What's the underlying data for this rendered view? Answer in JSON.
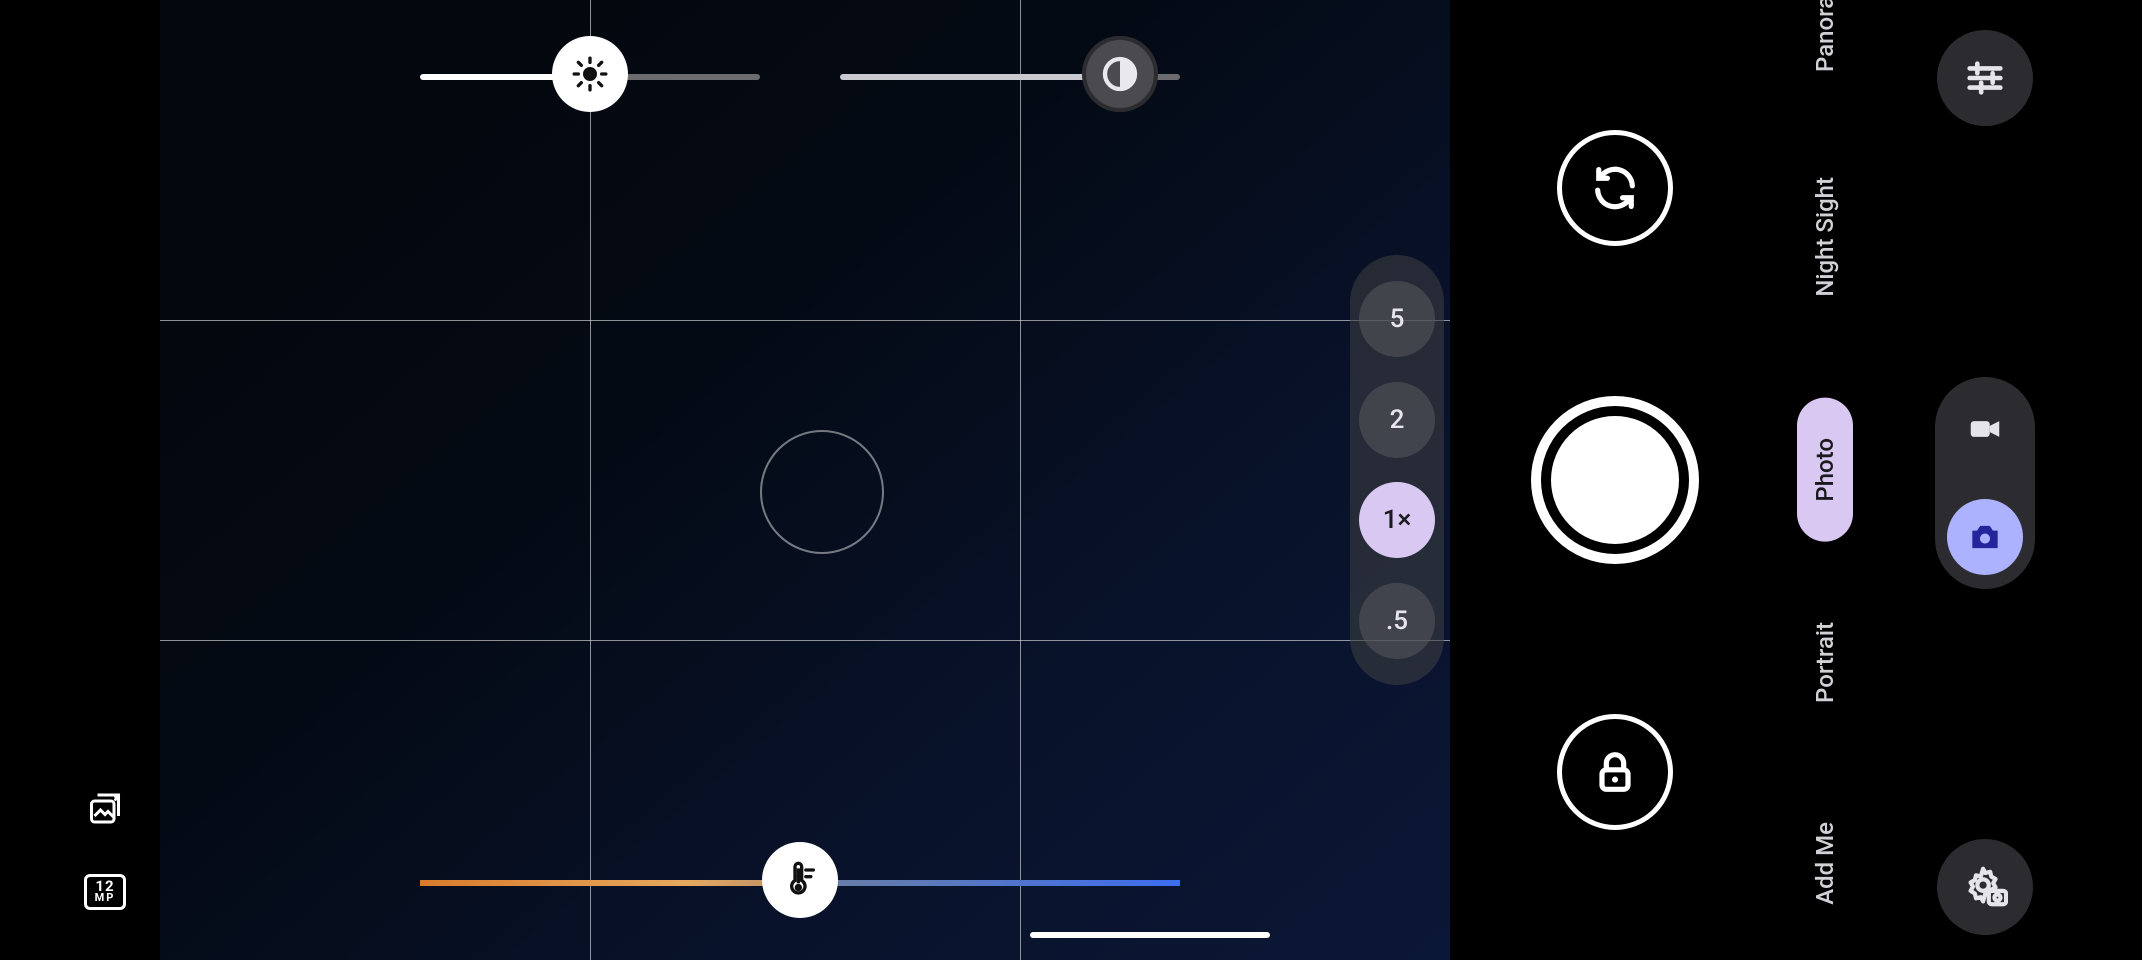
{
  "sliders": {
    "brightness": {
      "position_pct": 50
    },
    "contrast": {
      "position_pct": 82
    },
    "white_balance": {
      "position_pct": 50
    }
  },
  "zoom_options": [
    {
      "label": "5",
      "active": false
    },
    {
      "label": "2",
      "active": false
    },
    {
      "label": "1×",
      "active": true
    },
    {
      "label": ".5",
      "active": false
    }
  ],
  "resolution_badge": {
    "line1": "12",
    "line2": "MP"
  },
  "modes": [
    {
      "label": "Panorama",
      "active": false
    },
    {
      "label": "Night Sight",
      "active": false
    },
    {
      "label": "Photo",
      "active": true
    },
    {
      "label": "Portrait",
      "active": false
    },
    {
      "label": "Add Me",
      "active": false
    }
  ],
  "photo_video_toggle": {
    "video_active": false,
    "photo_active": true
  }
}
